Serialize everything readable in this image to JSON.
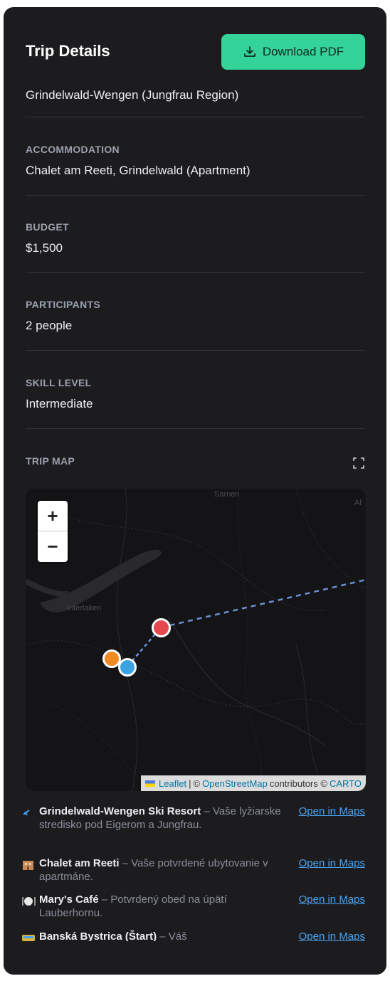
{
  "header": {
    "title": "Trip Details",
    "download_label": "Download PDF"
  },
  "destination": "Grindelwald-Wengen (Jungfrau Region)",
  "fields": [
    {
      "label": "ACCOMMODATION",
      "value": "Chalet am Reeti, Grindelwald (Apartment)"
    },
    {
      "label": "BUDGET",
      "value": "$1,500"
    },
    {
      "label": "PARTICIPANTS",
      "value": "2 people"
    },
    {
      "label": "SKILL LEVEL",
      "value": "Intermediate"
    }
  ],
  "map": {
    "label": "TRIP MAP",
    "zoom_in": "+",
    "zoom_out": "−",
    "towns": [
      "Sarnen",
      "Interlaken",
      "Al"
    ],
    "attribution": {
      "leaflet": "Leaflet",
      "sep": "|",
      "copy": "©",
      "osm": "OpenStreetMap",
      "contributors": "contributors ©",
      "carto": "CARTO"
    },
    "marker_colors": {
      "resort": "#e5484d",
      "chalet": "#3ba3e3",
      "cafe": "#f08a24"
    }
  },
  "pois": [
    {
      "icon": "ski-icon",
      "name": "Grindelwald-Wengen Ski Resort",
      "desc": "– Vaše lyžiarske stredisko pod Eigerom a Jungfrau.",
      "link": "Open in Maps"
    },
    {
      "icon": "hotel-icon",
      "name": "Chalet am Reeti",
      "desc": "– Vaše potvrdené ubytovanie v apartmáne.",
      "link": "Open in Maps"
    },
    {
      "icon": "plate-icon",
      "name": "Mary's Café",
      "desc": "– Potvrdený obed na úpätí Lauberhornu.",
      "link": "Open in Maps"
    },
    {
      "icon": "train-icon",
      "name": "Banská Bystrica (Štart)",
      "desc": "– Váš",
      "link": "Open in Maps"
    }
  ],
  "colors": {
    "accent": "#34d399",
    "panel": "#1c1c1f",
    "link": "#4aa3f0"
  }
}
